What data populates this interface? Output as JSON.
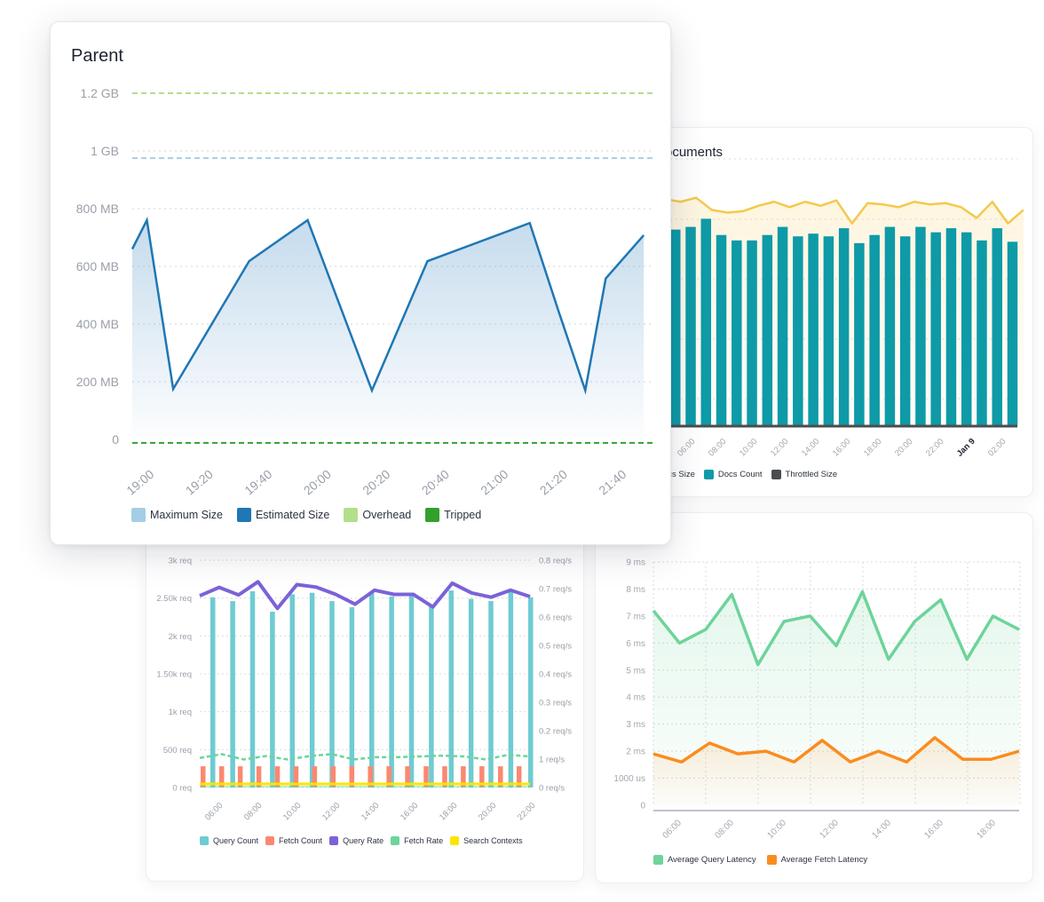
{
  "cards": {
    "parent": {
      "title": "Parent",
      "legend": [
        {
          "label": "Maximum Size",
          "color": "#a6cde6"
        },
        {
          "label": "Estimated Size",
          "color": "#1f77b4"
        },
        {
          "label": "Overhead",
          "color": "#b2df8a"
        },
        {
          "label": "Tripped",
          "color": "#33a02c"
        }
      ]
    },
    "documents": {
      "title": "Documents",
      "visible_title": "ocuments",
      "legend": [
        {
          "label": "ocs Size",
          "color": "#f5c84c",
          "partial": true
        },
        {
          "label": "Docs Count",
          "color": "#0e9aa7"
        },
        {
          "label": "Throttled Size",
          "color": "#4a4d4f"
        }
      ]
    },
    "search": {
      "legend": [
        {
          "label": "Query Count",
          "color": "#6fcbd2"
        },
        {
          "label": "Fetch Count",
          "color": "#fb8870"
        },
        {
          "label": "Query Rate",
          "color": "#7c62d8"
        },
        {
          "label": "Fetch Rate",
          "color": "#6dd49a"
        },
        {
          "label": "Search Contexts",
          "color": "#fde400"
        }
      ]
    },
    "latency": {
      "legend": [
        {
          "label": "Average Query Latency",
          "color": "#6dd49a"
        },
        {
          "label": "Average Fetch Latency",
          "color": "#fb8c1e"
        }
      ]
    }
  },
  "chart_data": [
    {
      "id": "parent",
      "type": "area",
      "title": "Parent",
      "ylabel": "",
      "y_ticks": [
        "0",
        "200 MB",
        "400 MB",
        "600 MB",
        "800 MB",
        "1 GB",
        "1.2 GB"
      ],
      "y_tick_values_mb": [
        0,
        200,
        400,
        600,
        800,
        1000,
        1200
      ],
      "ylim_mb": [
        0,
        1200
      ],
      "x_ticks": [
        "19:00",
        "19:20",
        "19:40",
        "20:00",
        "20:20",
        "20:40",
        "21:00",
        "21:20",
        "21:40"
      ],
      "x_range_minutes": [
        0,
        178
      ],
      "grid": true,
      "legend_position": "bottom-left",
      "series": [
        {
          "name": "Estimated Size",
          "type": "line+area",
          "color": "#1f77b4",
          "x_minutes": [
            -8,
            5,
            14,
            40,
            60,
            82,
            101,
            136,
            146,
            155,
            162,
            175
          ],
          "values_mb": [
            660,
            760,
            175,
            618,
            760,
            170,
            618,
            750,
            440,
            170,
            558,
            708
          ]
        },
        {
          "name": "Maximum Size",
          "type": "hline-dashed",
          "color": "#a6cde6",
          "value_mb": 975
        },
        {
          "name": "Overhead",
          "type": "hline-dashed",
          "color": "#b2df8a",
          "value_mb": 1200
        },
        {
          "name": "Tripped",
          "type": "hline-dashed",
          "color": "#33a02c",
          "value_mb": -12
        }
      ]
    },
    {
      "id": "documents",
      "type": "bar",
      "title": "Documents",
      "x_ticks": [
        "06:00",
        "08:00",
        "10:00",
        "12:00",
        "14:00",
        "16:00",
        "18:00",
        "20:00",
        "22:00",
        "Jan 9",
        "02:00"
      ],
      "x_ticks_bold": [
        "Jan 9"
      ],
      "grid": true,
      "legend_position": "bottom-left",
      "ylim": [
        0,
        100
      ],
      "series": [
        {
          "name": "Docs Count",
          "type": "bar",
          "color": "#0e9aa7",
          "values": [
            88,
            89,
            92,
            86,
            84,
            84,
            86,
            89,
            85.5,
            86.5,
            85.5,
            88.5,
            83,
            86,
            89,
            85.5,
            89,
            87,
            88.5,
            87,
            84,
            88.5,
            83.5
          ]
        },
        {
          "name": "Docs Size",
          "type": "line",
          "color": "#f5c84c",
          "values": [
            96,
            95,
            96.5,
            92,
            91,
            91.5,
            93.5,
            95,
            93,
            95,
            93.5,
            95.5,
            87,
            94.5,
            94,
            93,
            95,
            94,
            94.5,
            93,
            89,
            95,
            87,
            92
          ]
        },
        {
          "name": "Throttled Size",
          "type": "line",
          "color": "#4a4d4f",
          "value": 0
        }
      ]
    },
    {
      "id": "search",
      "type": "bar",
      "x_ticks": [
        "06:00",
        "08:00",
        "10:00",
        "12:00",
        "14:00",
        "16:00",
        "18:00",
        "20:00",
        "22:00"
      ],
      "y_left_ticks": [
        "0 req",
        "500 req",
        "1k req",
        "1.50k req",
        "2k req",
        "2.50k req",
        "3k req"
      ],
      "y_left_range": [
        0,
        3000
      ],
      "y_right_ticks": [
        "0 req/s",
        "1 req/s",
        "0.2 req/s",
        "0.3 req/s",
        "0.4 req/s",
        "0.5 req/s",
        "0.6 req/s",
        "0.7 req/s",
        "0.8 req/s"
      ],
      "grid": true,
      "legend_position": "bottom",
      "series": [
        {
          "name": "Query Count",
          "type": "bar",
          "axis": "left",
          "color": "#6fcbd2",
          "values": [
            2510,
            2460,
            2590,
            2320,
            2550,
            2570,
            2460,
            2380,
            2570,
            2520,
            2550,
            2400,
            2600,
            2490,
            2460,
            2580,
            2510
          ]
        },
        {
          "name": "Fetch Count",
          "type": "bar",
          "axis": "left",
          "color": "#fb8870",
          "values": [
            280,
            280,
            280,
            280,
            280,
            280,
            280,
            280,
            280,
            280,
            280,
            280,
            280,
            280,
            280,
            280,
            280,
            280
          ]
        },
        {
          "name": "Query Rate",
          "type": "line",
          "axis": "right_rate",
          "color": "#7c62d8",
          "values": [
            0.685,
            0.715,
            0.688,
            0.735,
            0.64,
            0.725,
            0.716,
            0.69,
            0.655,
            0.705,
            0.69,
            0.69,
            0.645,
            0.73,
            0.695,
            0.68,
            0.705,
            0.682
          ]
        },
        {
          "name": "Fetch Rate",
          "type": "line-dashed",
          "axis": "left",
          "color": "#6dd49a",
          "values": [
            390,
            440,
            370,
            415,
            370,
            415,
            440,
            370,
            400,
            400,
            410,
            420,
            410,
            370,
            430,
            410
          ]
        },
        {
          "name": "Search Contexts",
          "type": "line",
          "axis": "left",
          "color": "#fde400",
          "values": [
            20,
            20,
            20,
            20,
            20,
            20,
            20,
            20,
            20,
            20,
            20,
            20,
            20,
            20,
            20,
            20
          ]
        }
      ]
    },
    {
      "id": "latency",
      "type": "line",
      "x_ticks": [
        "06:00",
        "08:00",
        "10:00",
        "12:00",
        "14:00",
        "16:00",
        "18:00"
      ],
      "y_ticks": [
        "0",
        "1000 us",
        "2 ms",
        "3 ms",
        "4 ms",
        "5 ms",
        "6 ms",
        "7 ms",
        "8 ms",
        "9 ms"
      ],
      "ylim_ms": [
        0,
        9
      ],
      "grid": true,
      "legend_position": "bottom-left",
      "series": [
        {
          "name": "Average Query Latency",
          "color": "#6dd49a",
          "values_ms": [
            7.2,
            6.0,
            6.5,
            7.8,
            5.2,
            6.8,
            7.0,
            5.9,
            7.9,
            5.4,
            6.8,
            7.6,
            5.4,
            7.0,
            6.5
          ]
        },
        {
          "name": "Average Fetch Latency",
          "color": "#fb8c1e",
          "values_ms": [
            1.9,
            1.6,
            2.3,
            1.9,
            2.0,
            1.6,
            2.4,
            1.6,
            2.0,
            1.6,
            2.5,
            1.7,
            1.7,
            2.0
          ]
        }
      ]
    }
  ]
}
